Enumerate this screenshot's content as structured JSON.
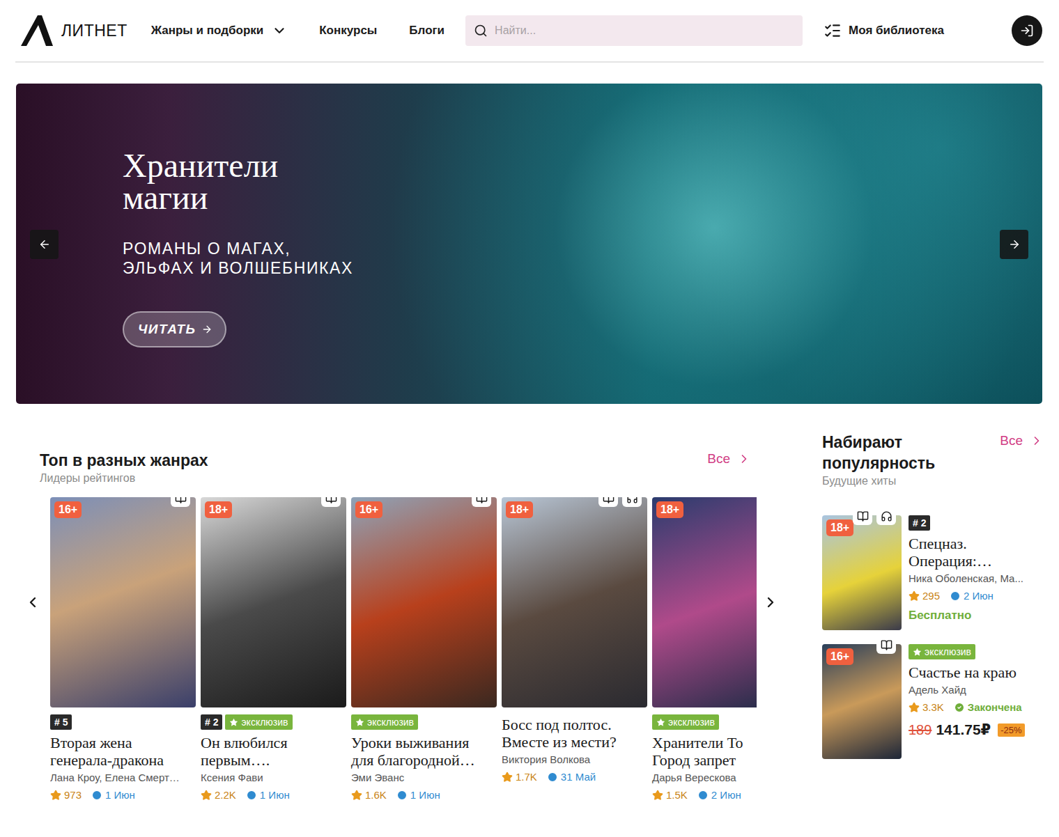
{
  "header": {
    "logo": "ЛИТНЕТ",
    "nav": [
      {
        "label": "Жанры и подборки",
        "dropdown": true
      },
      {
        "label": "Конкурсы",
        "dropdown": false
      },
      {
        "label": "Блоги",
        "dropdown": false
      }
    ],
    "search": {
      "placeholder": "Найти..."
    },
    "library": "Моя библиотека"
  },
  "banner": {
    "title_lines": [
      "Хранители",
      "магии"
    ],
    "subtitle_lines": [
      "РОМАНЫ О МАГАХ,",
      "ЭЛЬФАХ И ВОЛШЕБНИКАХ"
    ],
    "button": "ЧИТАТЬ"
  },
  "top": {
    "title": "Топ в разных жанрах",
    "subtitle": "Лидеры рейтингов",
    "all": "Все",
    "books": [
      {
        "age": "16+",
        "reader": true,
        "audio": false,
        "tags": [
          {
            "kind": "rank",
            "text": "# 5"
          }
        ],
        "title_lines": [
          "Вторая жена",
          "генерала-дракона"
        ],
        "author": "Лана Кроу, Елена Смерт…",
        "rating": "973",
        "date": "1 Июн"
      },
      {
        "age": "18+",
        "reader": true,
        "audio": false,
        "tags": [
          {
            "kind": "rank",
            "text": "# 2"
          },
          {
            "kind": "exclusive",
            "text": "эксклюзив"
          }
        ],
        "title_lines": [
          "Он влюбился",
          "первым…."
        ],
        "author": "Ксения Фави",
        "rating": "2.2K",
        "date": "1 Июн"
      },
      {
        "age": "16+",
        "reader": true,
        "audio": false,
        "tags": [
          {
            "kind": "exclusive",
            "text": "эксклюзив"
          }
        ],
        "title_lines": [
          "Уроки выживания",
          "для благородной…"
        ],
        "author": "Эми Эванс",
        "rating": "1.6K",
        "date": "1 Июн"
      },
      {
        "age": "18+",
        "reader": true,
        "audio": true,
        "tags": [],
        "title_lines": [
          "Босс под полтос.",
          "Вместе из мести?"
        ],
        "author": "Виктория Волкова",
        "rating": "1.7K",
        "date": "31 Май"
      },
      {
        "age": "18+",
        "reader": false,
        "audio": false,
        "tags": [
          {
            "kind": "exclusive",
            "text": "эксклюзив"
          }
        ],
        "title_lines": [
          "Хранители То",
          "Город запрет"
        ],
        "author": "Дарья Верескова",
        "rating": "1.5K",
        "date": "2 Июн"
      }
    ]
  },
  "rising": {
    "title_lines": [
      "Набирают",
      "популярность"
    ],
    "subtitle": "Будущие хиты",
    "all": "Все",
    "books": [
      {
        "age": "18+",
        "reader": true,
        "audio": true,
        "tags": [
          {
            "kind": "rank",
            "text": "# 2"
          }
        ],
        "title_lines": [
          "Спецназ.",
          "Операция:…"
        ],
        "author": "Ника Оболенская, Ма...",
        "rating": "295",
        "date": "2 Июн",
        "finished": null,
        "price": {
          "kind": "free",
          "text": "Бесплатно"
        }
      },
      {
        "age": "16+",
        "reader": true,
        "audio": false,
        "tags": [
          {
            "kind": "exclusive",
            "text": "эксклюзив"
          }
        ],
        "title_lines": [
          "Счастье на краю"
        ],
        "author": "Адель Хайд",
        "rating": "3.3K",
        "date": null,
        "finished": "Закончена",
        "price": {
          "kind": "sale",
          "old": "189",
          "new": "141.75₽",
          "discount": "-25%"
        }
      }
    ]
  }
}
